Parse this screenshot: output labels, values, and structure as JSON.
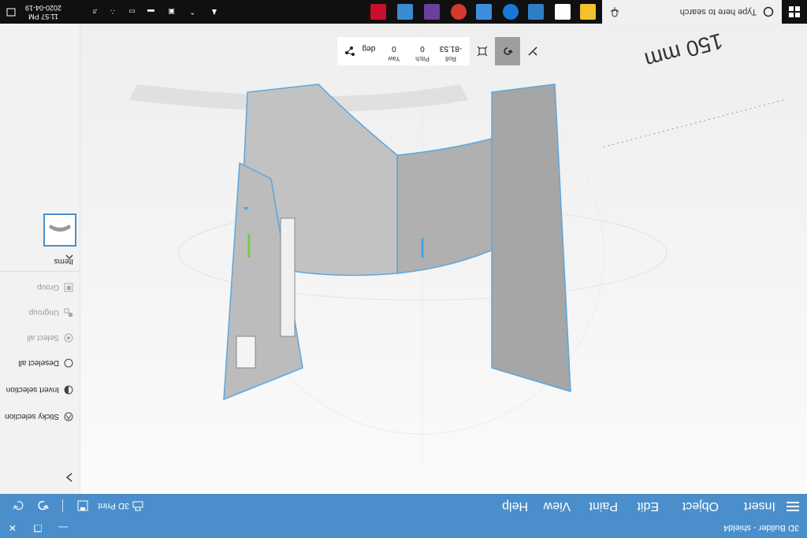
{
  "window": {
    "title": "3D Builder - shield4"
  },
  "menu": {
    "items": [
      "Insert",
      "Object",
      "Edit",
      "Paint",
      "View",
      "Help"
    ],
    "print_label": "3D Print"
  },
  "rotate_toolbar": {
    "roll_label": "Roll",
    "roll_value": "-81.53",
    "pitch_label": "Pitch",
    "pitch_value": "0",
    "yaw_label": "Yaw",
    "yaw_value": "0",
    "unit": "deg"
  },
  "side_panel": {
    "actions": [
      "Sticky selection",
      "Invert selection",
      "Deselect all",
      "Select all",
      "Ungroup",
      "Group"
    ],
    "items_label": "Items"
  },
  "scene": {
    "ruler_text": "150 mm"
  },
  "taskbar": {
    "search_placeholder": "Type here to search",
    "time": "11:57 PM",
    "date": "2020-04-19"
  },
  "colors": {
    "accent": "#4a8fcb",
    "taskbar": "#101010",
    "model": "#b4b4b4",
    "outline": "#5aa7e0"
  }
}
